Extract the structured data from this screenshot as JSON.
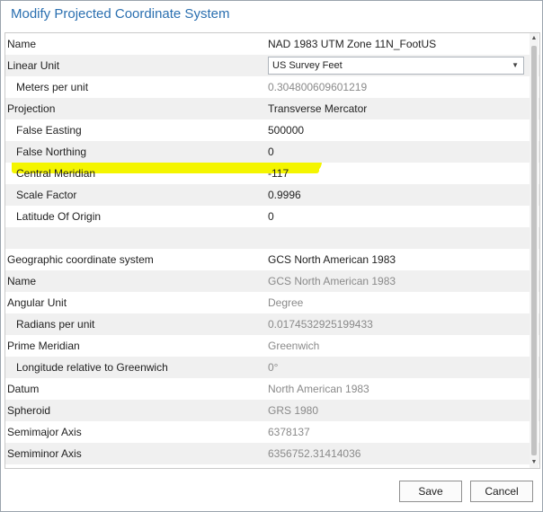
{
  "dialog": {
    "title": "Modify Projected Coordinate System",
    "save_label": "Save",
    "cancel_label": "Cancel"
  },
  "rows": {
    "name": {
      "label": "Name",
      "value": "NAD 1983 UTM Zone 11N_FootUS"
    },
    "linear_unit": {
      "label": "Linear Unit",
      "value": "US Survey Feet"
    },
    "meters_per_unit": {
      "label": "Meters per unit",
      "value": "0.304800609601219"
    },
    "projection": {
      "label": "Projection",
      "value": "Transverse Mercator"
    },
    "false_easting": {
      "label": "False Easting",
      "value": "500000"
    },
    "false_northing": {
      "label": "False Northing",
      "value": "0"
    },
    "central_meridian": {
      "label": "Central Meridian",
      "value": "-117"
    },
    "scale_factor": {
      "label": "Scale Factor",
      "value": "0.9996"
    },
    "latitude_of_origin": {
      "label": "Latitude Of Origin",
      "value": "0"
    },
    "gcs": {
      "label": "Geographic coordinate system",
      "value": "GCS North American 1983"
    },
    "gcs_name": {
      "label": "Name",
      "value": "GCS North American 1983"
    },
    "angular_unit": {
      "label": "Angular Unit",
      "value": "Degree"
    },
    "radians_per_unit": {
      "label": "Radians per unit",
      "value": "0.0174532925199433"
    },
    "prime_meridian": {
      "label": "Prime Meridian",
      "value": "Greenwich"
    },
    "longitude_rel": {
      "label": "Longitude relative to Greenwich",
      "value": "0°"
    },
    "datum": {
      "label": "Datum",
      "value": "North American 1983"
    },
    "spheroid": {
      "label": "Spheroid",
      "value": "GRS 1980"
    },
    "semimajor": {
      "label": "Semimajor Axis",
      "value": "6378137"
    },
    "semiminor": {
      "label": "Semiminor Axis",
      "value": "6356752.31414036"
    }
  },
  "colors": {
    "title": "#2a6fb0",
    "highlight": "#f4f500",
    "alt_row": "#f0f0f0",
    "dim_text": "#8a8a8a"
  }
}
